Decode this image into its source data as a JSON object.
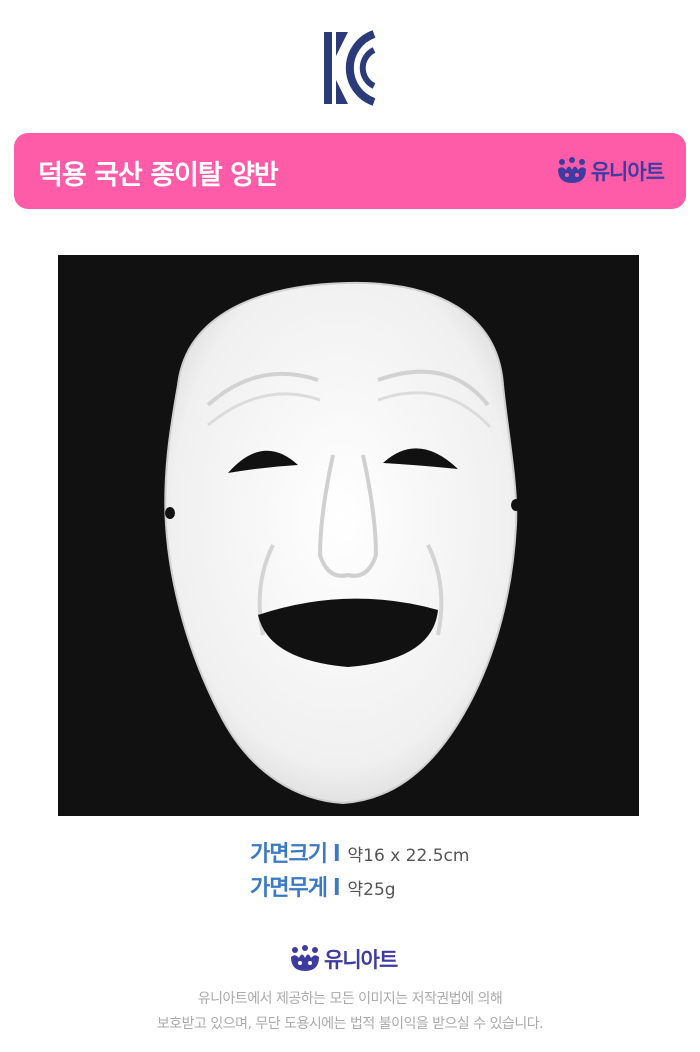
{
  "banner": {
    "title": "덕용 국산 종이탈 양반",
    "brand": "유니아트",
    "background_color": "#fe5ca9"
  },
  "certification": {
    "icon": "kc-mark-icon"
  },
  "product_image": {
    "description_icon": "white-paper-mask-image"
  },
  "specs": [
    {
      "label": "가면크기",
      "separator": "l",
      "value": "약16 x 22.5cm"
    },
    {
      "label": "가면무게",
      "separator": "l",
      "value": "약25g"
    }
  ],
  "footer": {
    "brand": "유니아트",
    "notice_line1": "유니아트에서 제공하는 모든 이미지는 저작권법에 의해",
    "notice_line2": "보호받고 있으며, 무단 도용시에는 법적 불이익을 받으실 수 있습니다."
  },
  "colors": {
    "brand_purple": "#3f3ca1",
    "spec_blue": "#3a79c3",
    "kc_navy": "#2b3a78"
  }
}
